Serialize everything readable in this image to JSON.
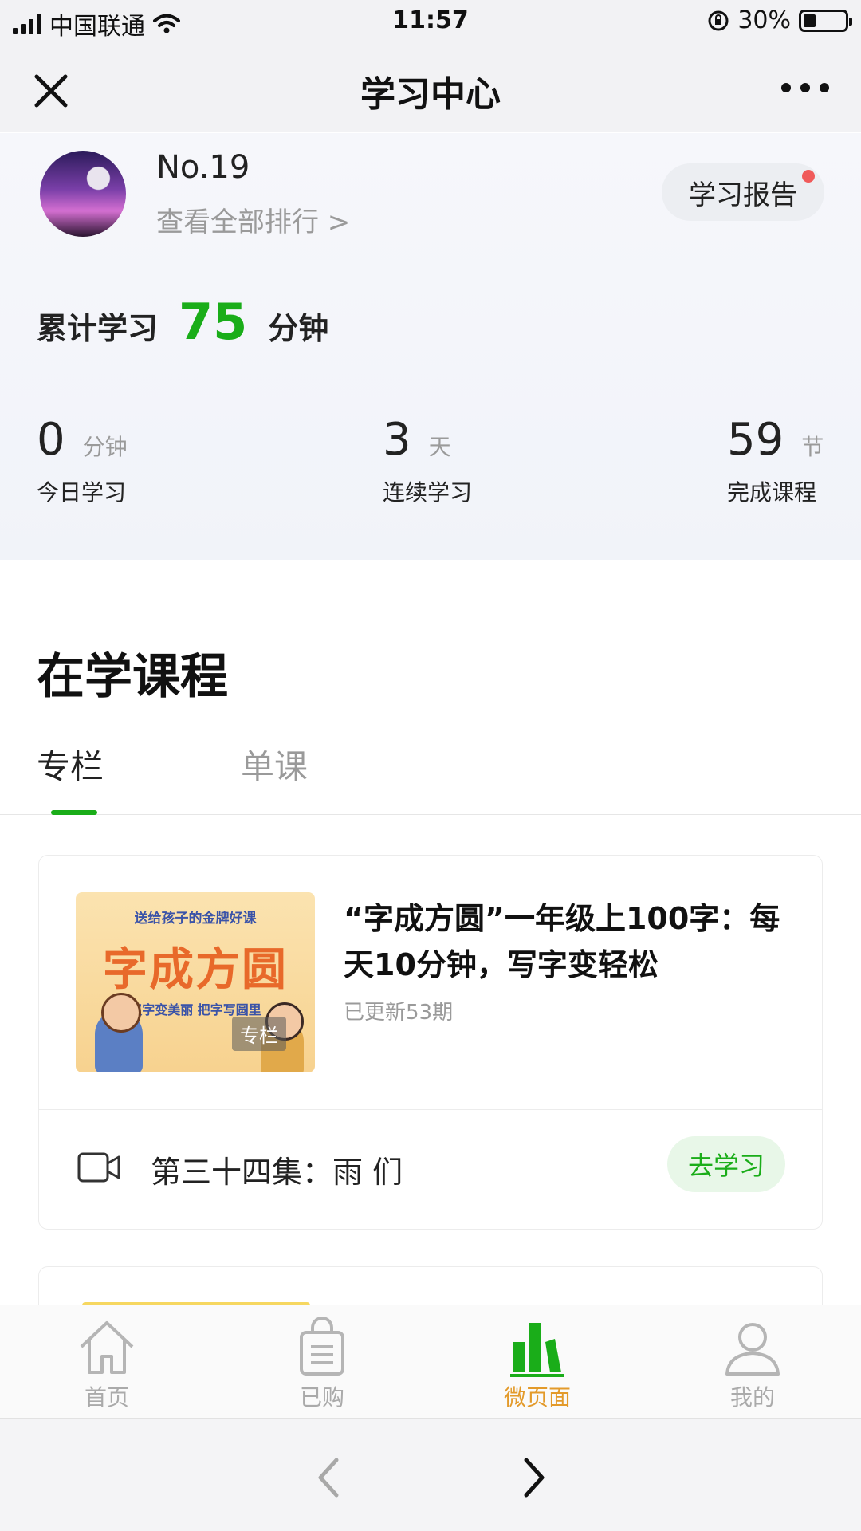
{
  "status_bar": {
    "carrier": "中国联通",
    "time": "11:57",
    "battery": "30%",
    "battery_level": 0.3,
    "icons": [
      "signal-icon",
      "wifi-icon",
      "orientation-lock-icon",
      "battery-icon"
    ]
  },
  "nav": {
    "title": "学习中心",
    "close_icon": "close-icon",
    "more_icon": "more-icon"
  },
  "profile": {
    "rank": "No.19",
    "rank_link": "查看全部排行 >",
    "report_button": "学习报告"
  },
  "total": {
    "label": "累计学习",
    "value": "75",
    "unit": "分钟",
    "value_color": "#1aad19"
  },
  "stats": [
    {
      "value": "0",
      "unit": "分钟",
      "label": "今日学习"
    },
    {
      "value": "3",
      "unit": "天",
      "label": "连续学习"
    },
    {
      "value": "59",
      "unit": "节",
      "label": "完成课程"
    }
  ],
  "courses": {
    "section_title": "在学课程",
    "tabs": [
      {
        "label": "专栏",
        "active": true
      },
      {
        "label": "单课",
        "active": false
      }
    ],
    "items": [
      {
        "cover": {
          "top_text": "送给孩子的金牌好课",
          "big_text": "字成方圆",
          "sub_text": "汉字变美丽  把字写圆里",
          "tag": "专栏"
        },
        "title": "“字成方圆”一年级上100字：每天10分钟，写字变轻松",
        "meta": "已更新53期",
        "episode": "第三十四集：雨 们",
        "action": "去学习"
      }
    ]
  },
  "tab_bar": {
    "items": [
      {
        "label": "首页",
        "icon": "home-icon",
        "active": false
      },
      {
        "label": "已购",
        "icon": "shopping-bag-icon",
        "active": false
      },
      {
        "label": "微页面",
        "icon": "bar-chart-icon",
        "active": true
      },
      {
        "label": "我的",
        "icon": "user-icon",
        "active": false
      }
    ]
  },
  "colors": {
    "accent_green": "#1aad19",
    "active_tab_label": "#e39a2a",
    "notification_dot": "#f05a5a"
  }
}
